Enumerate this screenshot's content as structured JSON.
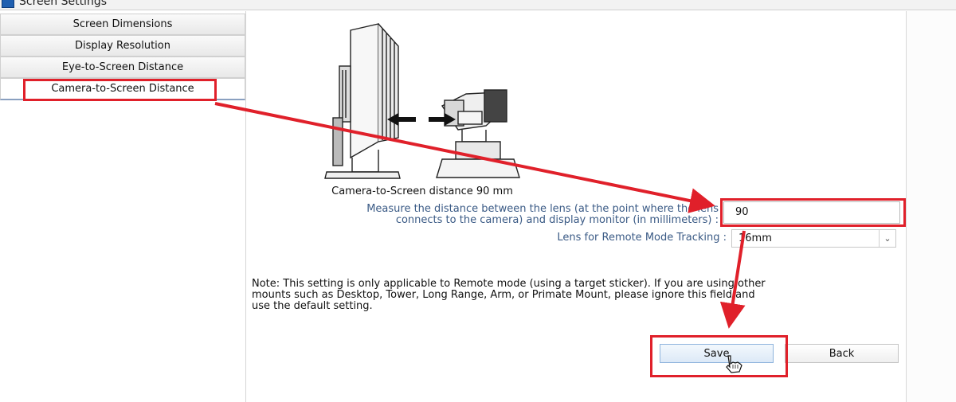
{
  "window": {
    "title": "Screen Settings",
    "icon": "screen-settings-icon"
  },
  "sidebar": {
    "items": [
      {
        "label": "Screen Dimensions",
        "active": false
      },
      {
        "label": "Display Resolution",
        "active": false
      },
      {
        "label": "Eye-to-Screen Distance",
        "active": false
      },
      {
        "label": "Camera-to-Screen Distance",
        "active": true
      }
    ]
  },
  "main": {
    "caption": "Camera-to-Screen distance 90 mm",
    "measure_label_line1": "Measure the distance between the lens (at the point where the lens",
    "measure_label_line2": "connects to the camera) and display monitor (in millimeters) :",
    "distance_value": "90",
    "lens_label": "Lens for Remote Mode Tracking :",
    "lens_value": "16mm",
    "note_line1": "Note: This setting is only applicable to Remote mode (using a target sticker). If you are using other",
    "note_line2": "mounts such as Desktop, Tower, Long Range, Arm, or Primate Mount, please ignore this field and",
    "note_line3": "use the default setting.",
    "save_label": "Save",
    "back_label": "Back"
  },
  "annotations": {
    "highlight_color": "#e0202a"
  }
}
